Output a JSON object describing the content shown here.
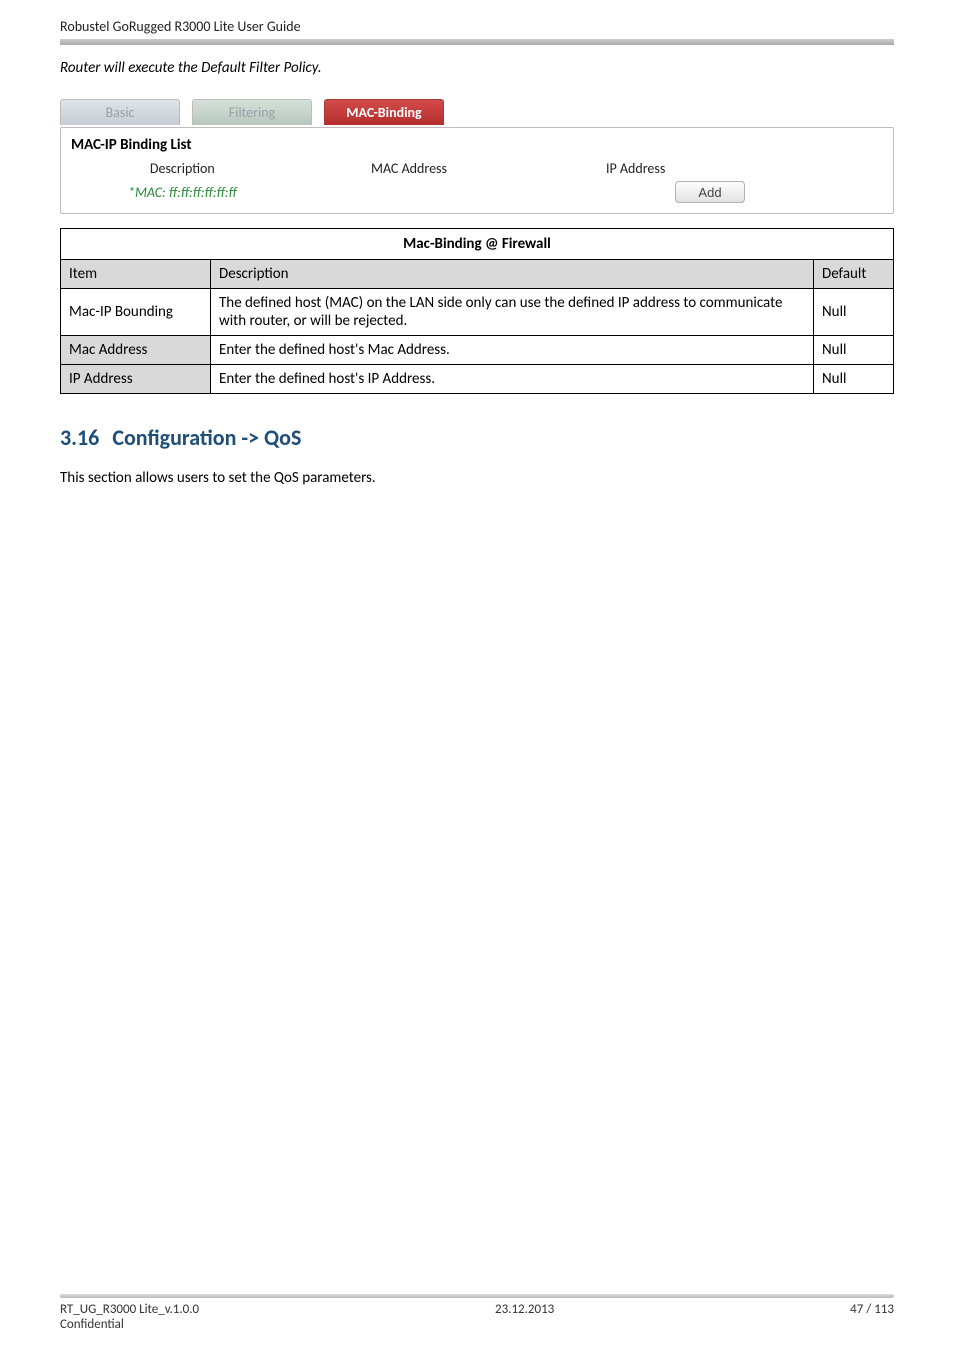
{
  "header": {
    "doc_title": "Robustel GoRugged R3000 Lite User Guide"
  },
  "note_line": "Router will execute the Default Filter Policy.",
  "tabs": {
    "basic": "Basic",
    "filtering": "Filtering",
    "mac": "MAC-Binding"
  },
  "binding_panel": {
    "heading": "MAC-IP Binding List",
    "cols": {
      "desc": "Description",
      "mac": "MAC Address",
      "ip": "IP Address"
    },
    "mac_sample": "*MAC: ff:ff:ff:ff:ff:ff",
    "add_label": "Add"
  },
  "table": {
    "title": "Mac-Binding @ Firewall",
    "head": {
      "item": "Item",
      "desc": "Description",
      "default": "Default"
    },
    "rows": [
      {
        "item": "Mac-IP Bounding",
        "desc": "The defined host (MAC) on the LAN side only can use the defined IP address to communicate with router, or will be rejected.",
        "default": "Null",
        "shaded": false
      },
      {
        "item": "Mac Address",
        "desc": "Enter the defined host's Mac Address.",
        "default": "Null",
        "shaded": true
      },
      {
        "item": "IP Address",
        "desc": "Enter the defined host's IP Address.",
        "default": "Null",
        "shaded": false
      }
    ]
  },
  "section": {
    "number": "3.16",
    "title": "Configuration -> QoS",
    "intro": "This section allows users to set the QoS parameters."
  },
  "footer": {
    "left1": "RT_UG_R3000 Lite_v.1.0.0",
    "left2": "Confidential",
    "center": "23.12.2013",
    "right": "47 / 113"
  }
}
